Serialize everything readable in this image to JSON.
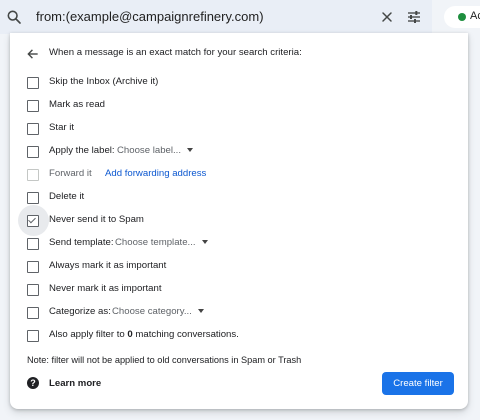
{
  "search": {
    "query": "from:(example@campaignrefinery.com)",
    "icons": {
      "search": "search-icon",
      "clear": "close-icon",
      "options": "tune-icon"
    }
  },
  "status": {
    "text": "Ac",
    "dot_color": "#1e8e3e"
  },
  "panel": {
    "header": "When a message is an exact match for your search criteria:",
    "options": {
      "skip_inbox": "Skip the Inbox (Archive it)",
      "mark_read": "Mark as read",
      "star": "Star it",
      "apply_label": "Apply the label:",
      "apply_label_dropdown": "Choose label...",
      "forward": "Forward it",
      "forward_link": "Add forwarding address",
      "delete": "Delete it",
      "never_spam": "Never send it to Spam",
      "send_template": "Send template:",
      "send_template_dropdown": "Choose template...",
      "always_important": "Always mark it as important",
      "never_important": "Never mark it as important",
      "categorize": "Categorize as:",
      "categorize_dropdown": "Choose category...",
      "also_apply_prefix": "Also apply filter to ",
      "also_apply_count": "0",
      "also_apply_suffix": " matching conversations."
    },
    "checked": {
      "never_spam": true
    },
    "note": "Note: filter will not be applied to old conversations in Spam or Trash",
    "learn_more": "Learn more",
    "create_button": "Create filter",
    "accent_color": "#1a73e8"
  }
}
